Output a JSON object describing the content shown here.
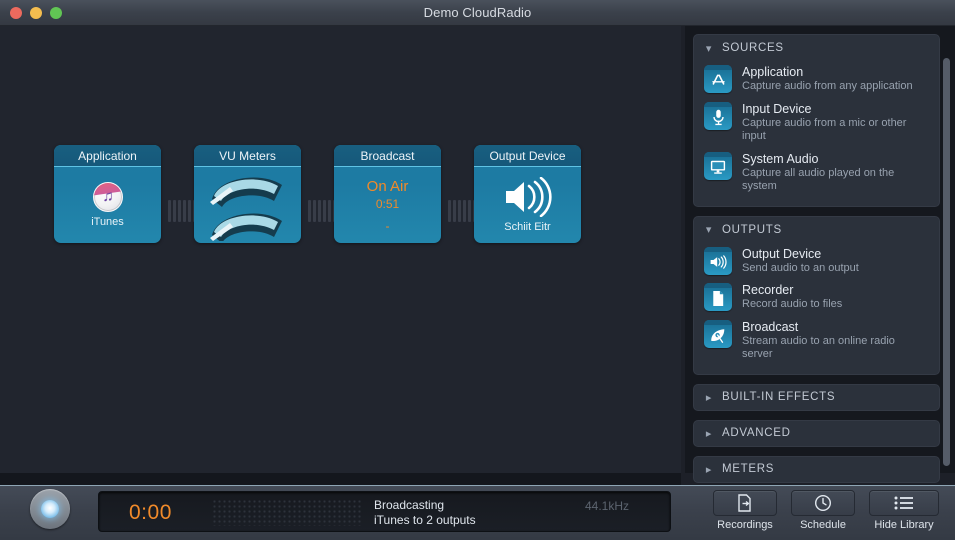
{
  "window": {
    "title": "Demo CloudRadio",
    "controls": [
      "close",
      "minimize",
      "zoom"
    ]
  },
  "canvas": {
    "nodes": [
      {
        "id": "application",
        "header": "Application",
        "icon": "itunes-icon",
        "caption": "iTunes"
      },
      {
        "id": "vu-meters",
        "header": "VU Meters",
        "icon": "vu-meter-icon",
        "caption": ""
      },
      {
        "id": "broadcast",
        "header": "Broadcast",
        "status": "On Air",
        "time": "0:51",
        "detail": "-"
      },
      {
        "id": "output-device",
        "header": "Output Device",
        "icon": "speaker-icon",
        "caption": "Schiit Eitr"
      }
    ]
  },
  "library": {
    "groups": [
      {
        "title": "SOURCES",
        "expanded": true,
        "items": [
          {
            "title": "Application",
            "subtitle": "Capture audio from any application",
            "icon": "app-store-icon"
          },
          {
            "title": "Input Device",
            "subtitle": "Capture audio from a mic or other input",
            "icon": "microphone-icon"
          },
          {
            "title": "System Audio",
            "subtitle": "Capture all audio played on the system",
            "icon": "monitor-icon"
          }
        ]
      },
      {
        "title": "OUTPUTS",
        "expanded": true,
        "items": [
          {
            "title": "Output Device",
            "subtitle": "Send audio to an output",
            "icon": "speaker-icon"
          },
          {
            "title": "Recorder",
            "subtitle": "Record audio to files",
            "icon": "document-icon"
          },
          {
            "title": "Broadcast",
            "subtitle": "Stream audio to an online radio server",
            "icon": "satellite-dish-icon"
          }
        ]
      }
    ],
    "collapsed_groups": [
      {
        "title": "BUILT-IN EFFECTS"
      },
      {
        "title": "ADVANCED"
      },
      {
        "title": "METERS"
      }
    ]
  },
  "toolbar": {
    "power_button": "power-toggle",
    "display": {
      "time": "0:00",
      "line1": "Broadcasting",
      "line2": "iTunes to 2 outputs",
      "sample_rate": "44.1kHz"
    },
    "buttons": [
      {
        "label": "Recordings",
        "icon": "recordings-icon"
      },
      {
        "label": "Schedule",
        "icon": "clock-icon"
      },
      {
        "label": "Hide Library",
        "icon": "list-icon"
      }
    ]
  },
  "colors": {
    "node_blue": "#1d7ba3",
    "node_header": "#16587a",
    "accent_orange": "#f08a2a",
    "canvas_bg": "#21252e",
    "library_bg": "#15181e"
  }
}
